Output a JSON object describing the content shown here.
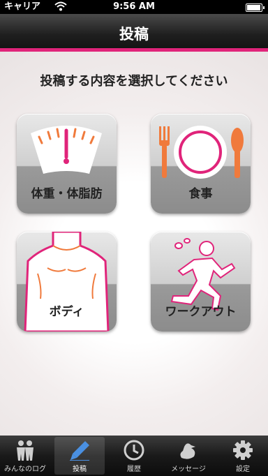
{
  "status_bar": {
    "carrier": "キャリア",
    "time": "9:56 AM"
  },
  "nav": {
    "title": "投稿"
  },
  "prompt": "投稿する内容を選択してください",
  "tiles": [
    {
      "label": "体重・体脂肪",
      "icon": "scale-icon"
    },
    {
      "label": "食事",
      "icon": "plate-icon"
    },
    {
      "label": "ボディ",
      "icon": "body-icon"
    },
    {
      "label": "ワークアウト",
      "icon": "runner-icon"
    }
  ],
  "tabs": [
    {
      "label": "みんなのログ",
      "icon": "people-icon",
      "active": false
    },
    {
      "label": "投稿",
      "icon": "pencil-icon",
      "active": true
    },
    {
      "label": "履歴",
      "icon": "clock-icon",
      "active": false
    },
    {
      "label": "メッセージ",
      "icon": "bird-icon",
      "active": false
    },
    {
      "label": "設定",
      "icon": "gear-icon",
      "active": false
    }
  ],
  "colors": {
    "accent": "#e0247a",
    "orange": "#f07a3c"
  }
}
